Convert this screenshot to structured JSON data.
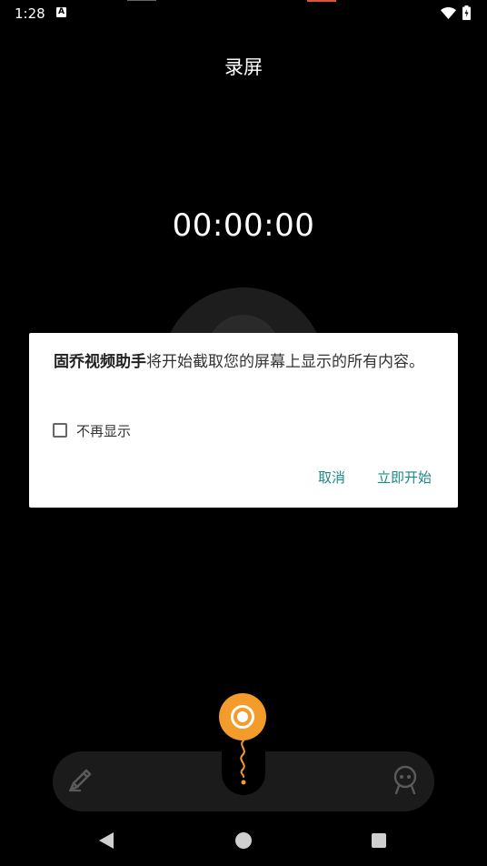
{
  "status_bar": {
    "time": "1:28",
    "notification_letter": "A",
    "icons": [
      "wifi-icon",
      "battery-icon"
    ]
  },
  "page": {
    "title": "录屏"
  },
  "recorder": {
    "timer": "00:00:00"
  },
  "dialog": {
    "app_name": "固乔视频助手",
    "message": "将开始截取您的屏幕上显示的所有内容。",
    "checkbox_label": "不再显示",
    "checkbox_checked": false,
    "cancel_label": "取消",
    "start_label": "立即开始",
    "button_color": "#1a8a86"
  },
  "toolbar": {
    "icons": [
      "brush-icon",
      "record-icon",
      "face-icon"
    ],
    "accent_color": "#f39b2b"
  },
  "nav_bar": {
    "icons": [
      "back-icon",
      "home-icon",
      "recents-icon"
    ]
  }
}
